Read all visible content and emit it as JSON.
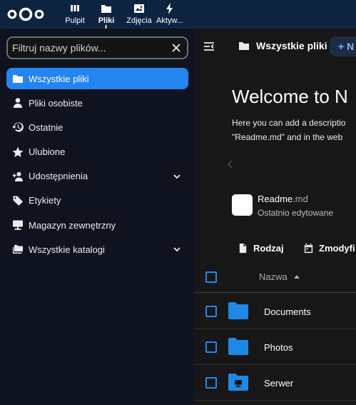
{
  "header": {
    "apps": [
      {
        "label": "Pulpit",
        "icon": "dashboard-icon"
      },
      {
        "label": "Pliki",
        "icon": "folder-icon",
        "active": true
      },
      {
        "label": "Zdjęcia",
        "icon": "image-icon"
      },
      {
        "label": "Aktyw...",
        "icon": "lightning-icon"
      }
    ]
  },
  "sidebar": {
    "filter_placeholder": "Filtruj nazwy plików...",
    "items": [
      {
        "label": "Wszystkie pliki",
        "icon": "folder-icon",
        "active": true
      },
      {
        "label": "Pliki osobiste",
        "icon": "user-icon"
      },
      {
        "label": "Ostatnie",
        "icon": "history-icon"
      },
      {
        "label": "Ulubione",
        "icon": "star-icon"
      },
      {
        "label": "Udostępnienia",
        "icon": "share-user-icon",
        "expandable": true
      },
      {
        "label": "Etykiety",
        "icon": "tag-icon"
      },
      {
        "label": "Magazyn zewnętrzny",
        "icon": "external-storage-icon"
      },
      {
        "label": "Wszystkie katalogi",
        "icon": "folders-icon",
        "expandable": true
      }
    ]
  },
  "main": {
    "breadcrumb": "Wszystkie pliki",
    "new_button": "+ N",
    "welcome_title": "Welcome to N",
    "description_line1": "Here you can add a descriptio",
    "description_line2": "\"Readme.md\" and in the web",
    "readme": {
      "name": "Readme",
      "ext": ".md",
      "meta": "Ostatnio edytowane"
    },
    "filters": {
      "type": "Rodzaj",
      "modified": "Zmodyfi"
    },
    "list": {
      "column_name": "Nazwa",
      "rows": [
        {
          "name": "Documents",
          "icon": "folder-icon"
        },
        {
          "name": "Photos",
          "icon": "folder-icon"
        },
        {
          "name": "Serwer",
          "icon": "external-folder-icon"
        }
      ]
    }
  },
  "colors": {
    "accent": "#2386f0",
    "header_bg": "#0d2340",
    "sidebar_bg": "#0f1320",
    "main_bg": "#171717"
  }
}
